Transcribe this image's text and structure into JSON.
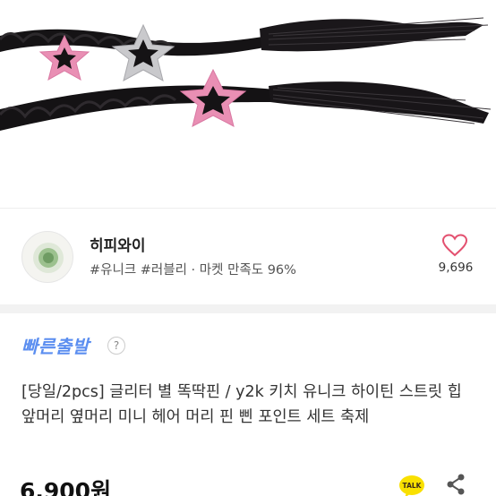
{
  "product": {
    "image_alt_icon": "hair-extension-star-pins-photo"
  },
  "seller": {
    "name": "히피와이",
    "tags": "#유니크 #러블리 · 마켓 만족도 96%",
    "likes": "9,696",
    "heart_color": "#e3506f"
  },
  "shipping": {
    "badge": "빠른출발",
    "help": "?"
  },
  "listing": {
    "title": "[당일/2pcs] 글리터 별 똑딱핀 / y2k 키치 유니크 하이틴 스트릿 힙 앞머리 옆머리 미니 헤어 머리 핀 삔 포인트 세트 축제",
    "price": "6,900원"
  },
  "actions": {
    "talk_label": "TALK",
    "talk_color": "#f9e000",
    "share_icon": "share-icon"
  },
  "colors": {
    "accent": "#5b8ef0",
    "star_pink": "#e98fb4",
    "star_silver": "#c9c9cc",
    "hair": "#141214"
  }
}
